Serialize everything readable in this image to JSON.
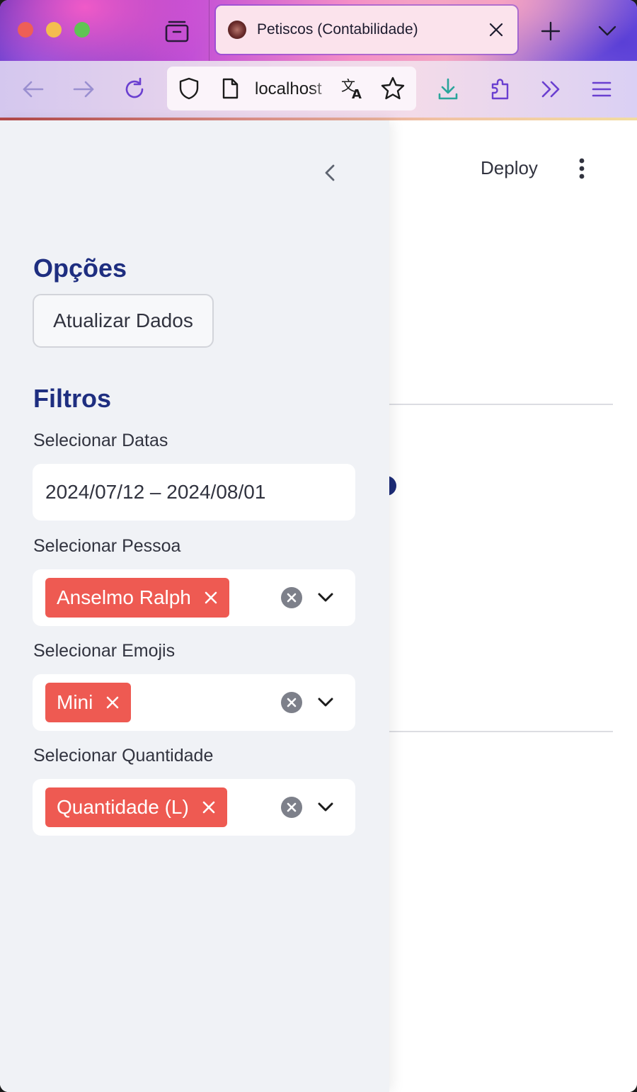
{
  "browser": {
    "tab": {
      "title": "Petiscos (Contabilidade)"
    },
    "url": "localhost",
    "colors": {
      "accent": "#7b47d6",
      "downloads": "#2ba59b"
    }
  },
  "main": {
    "deploy_label": "Deploy"
  },
  "sidebar": {
    "options_heading": "Opções",
    "refresh_button": "Atualizar Dados",
    "filters_heading": "Filtros",
    "date_filter": {
      "label": "Selecionar Datas",
      "value": "2024/07/12 – 2024/08/01"
    },
    "person_filter": {
      "label": "Selecionar Pessoa",
      "selected": [
        "Anselmo Ralph"
      ]
    },
    "emoji_filter": {
      "label": "Selecionar Emojis",
      "selected": [
        "Mini"
      ]
    },
    "quantity_filter": {
      "label": "Selecionar Quantidade",
      "selected": [
        "Quantidade (L)"
      ]
    }
  },
  "colors": {
    "heading": "#1e2e80",
    "chip": "#ee5a52",
    "sidebar_bg": "#f0f2f6"
  }
}
